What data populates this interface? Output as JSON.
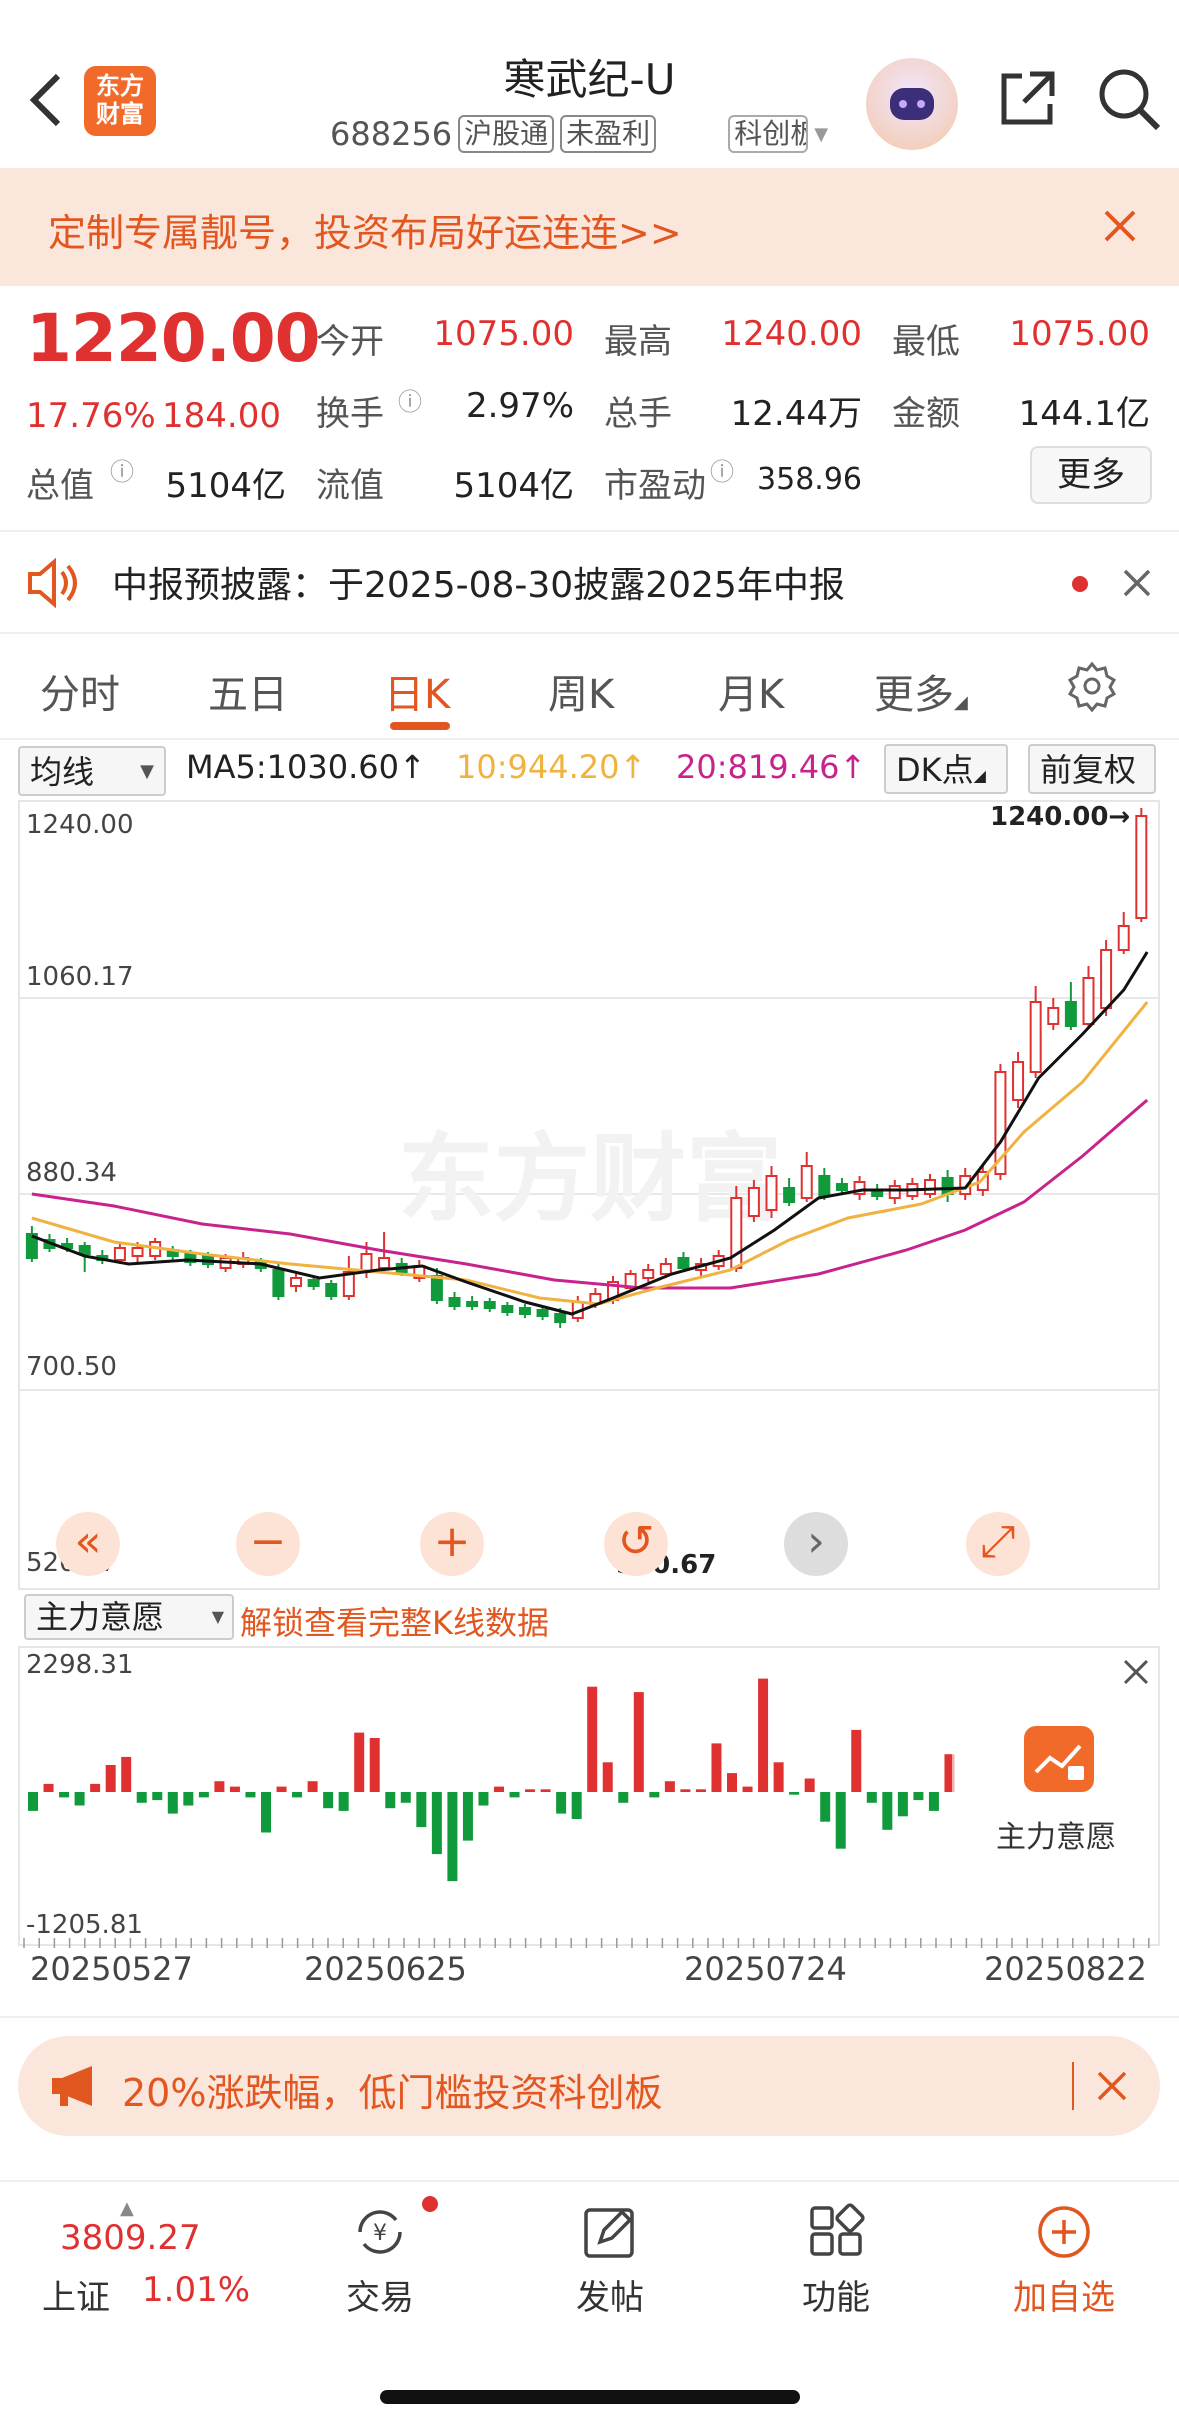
{
  "header": {
    "logo_text": "东方\n财富",
    "title": "寒武纪-U",
    "code": "688256",
    "tags": [
      "沪股通",
      "未盈利",
      "科创板"
    ]
  },
  "banner": {
    "text": "定制专属靓号，投资布局好运连连>>"
  },
  "quote": {
    "price": "1220.00",
    "change_pct": "17.76%",
    "change_amt": "184.00",
    "open_label": "今开",
    "open": "1075.00",
    "high_label": "最高",
    "high": "1240.00",
    "low_label": "最低",
    "low": "1075.00",
    "turnover_label": "换手",
    "turnover": "2.97%",
    "volume_label": "总手",
    "volume": "12.44万",
    "amount_label": "金额",
    "amount": "144.1亿",
    "mcap_label": "总值",
    "mcap": "5104亿",
    "float_label": "流值",
    "float": "5104亿",
    "pe_label": "市盈动",
    "pe": "358.96",
    "more_label": "更多"
  },
  "notice": {
    "text": "中报预披露：于2025-08-30披露2025年中报"
  },
  "tabs": [
    "分时",
    "五日",
    "日K",
    "周K",
    "月K",
    "更多"
  ],
  "active_tab": 2,
  "ma_bar": {
    "selector": "均线",
    "ma5": "MA5:1030.60↑",
    "ma10": "10:944.20↑",
    "ma20": "20:819.46↑",
    "dk": "DK点",
    "adjust": "前复权"
  },
  "kchart": {
    "y_labels": [
      "1240.00",
      "1060.17",
      "880.34",
      "700.50",
      "520.67"
    ],
    "max_label": "1240.00→",
    "min_label": "520.67",
    "watermark": "东方财富"
  },
  "indicator": {
    "selector": "主力意愿",
    "unlock_text": "解锁查看完整K线数据",
    "top_label": "2298.31",
    "bottom_label": "-1205.81",
    "side_label": "主力意愿",
    "dates": [
      "20250527",
      "20250625",
      "20250724",
      "20250822"
    ]
  },
  "promo": {
    "text": "20%涨跌幅，低门槛投资科创板"
  },
  "bottom_nav": {
    "index_value": "3809.27",
    "index_name": "上证",
    "index_change": "1.01%",
    "items": [
      "交易",
      "发帖",
      "功能",
      "加自选"
    ]
  },
  "colors": {
    "up": "#e03131",
    "down": "#109a3c",
    "accent": "#e2561f",
    "ma5": "#111111",
    "ma10": "#f0b240",
    "ma20": "#c8238c"
  }
}
